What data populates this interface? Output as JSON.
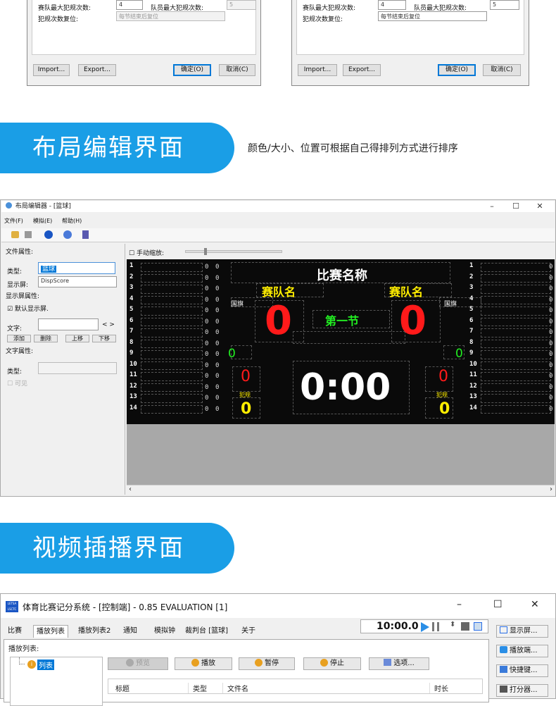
{
  "dialogs": [
    {
      "team_max_fouls_label": "赛队最大犯规次数:",
      "team_max_fouls_value": "4",
      "player_max_fouls_label": "队员最大犯规次数:",
      "player_max_fouls_value": "5",
      "foul_reset_label": "犯规次数复位:",
      "foul_reset_value": "每节结束后复位",
      "import_label": "Import...",
      "export_label": "Export...",
      "ok_label": "确定(O)",
      "cancel_label": "取消(C)"
    },
    {
      "team_max_fouls_label": "赛队最大犯规次数:",
      "team_max_fouls_value": "4",
      "player_max_fouls_label": "队员最大犯规次数:",
      "player_max_fouls_value": "5",
      "foul_reset_label": "犯规次数复位:",
      "foul_reset_value": "每节结束后复位",
      "import_label": "Import...",
      "export_label": "Export...",
      "ok_label": "确定(O)",
      "cancel_label": "取消(C)"
    }
  ],
  "layout_section": {
    "banner": "布局编辑界面",
    "caption": "颜色/大小、位置可根据自己得排列方式进行排序"
  },
  "layout_editor": {
    "title": "布局编辑器 - [篮球]",
    "menus": [
      "文件(F)",
      "模拟(E)",
      "帮助(H)"
    ],
    "file_props": "文件属性:",
    "type_label": "类型:",
    "type_value": "篮球",
    "display_label": "显示屏:",
    "display_value": "DispScore",
    "display_props": "显示屏属性:",
    "default_display": "默认显示屏.",
    "text_label": "文字:",
    "text_arrows": "< >",
    "add_btn": "添加",
    "del_btn": "删除",
    "up_btn": "上移",
    "down_btn": "下移",
    "text_props": "文字属性:",
    "type2_label": "类型:",
    "visible_label": "可见",
    "manual_zoom": "手动缩放:",
    "board": {
      "title": "比赛名称",
      "team_left": "赛队名",
      "team_right": "赛队名",
      "flag_left": "国旗",
      "flag_right": "国旗",
      "score_left": "0",
      "score_right": "0",
      "period": "第一节",
      "timeouts_left": "0",
      "timeouts_right": "0",
      "fouls_left": "0",
      "fouls_right": "0",
      "foul_label_left": "犯规",
      "foul_label_right": "犯规",
      "bonus_left": "0",
      "bonus_right": "0",
      "clock": "0:00",
      "rows": [
        "1",
        "2",
        "3",
        "4",
        "5",
        "6",
        "7",
        "8",
        "9",
        "10",
        "11",
        "12",
        "13",
        "14"
      ]
    }
  },
  "video_section": {
    "banner": "视频插播界面"
  },
  "control_app": {
    "logo": "LETSA LSCTC",
    "title": "体育比赛记分系统 - [控制端] - 0.85 EVALUATION [1]",
    "tabs": [
      "比赛",
      "播放列表",
      "播放列表2",
      "通知",
      "模拟钟",
      "裁判台 [篮球]",
      "关于"
    ],
    "active_tab": 1,
    "timer": "10:00.0",
    "playlist_label": "播放列表:",
    "tree_item": "列表",
    "preview_btn": "预览",
    "play_btn": "播放",
    "pause_btn": "暂停",
    "stop_btn": "停止",
    "options_btn": "选项...",
    "columns": [
      "标题",
      "类型",
      "文件名",
      "时长"
    ],
    "side_buttons": [
      "显示屏...",
      "播放端...",
      "快捷键...",
      "打分器..."
    ]
  }
}
